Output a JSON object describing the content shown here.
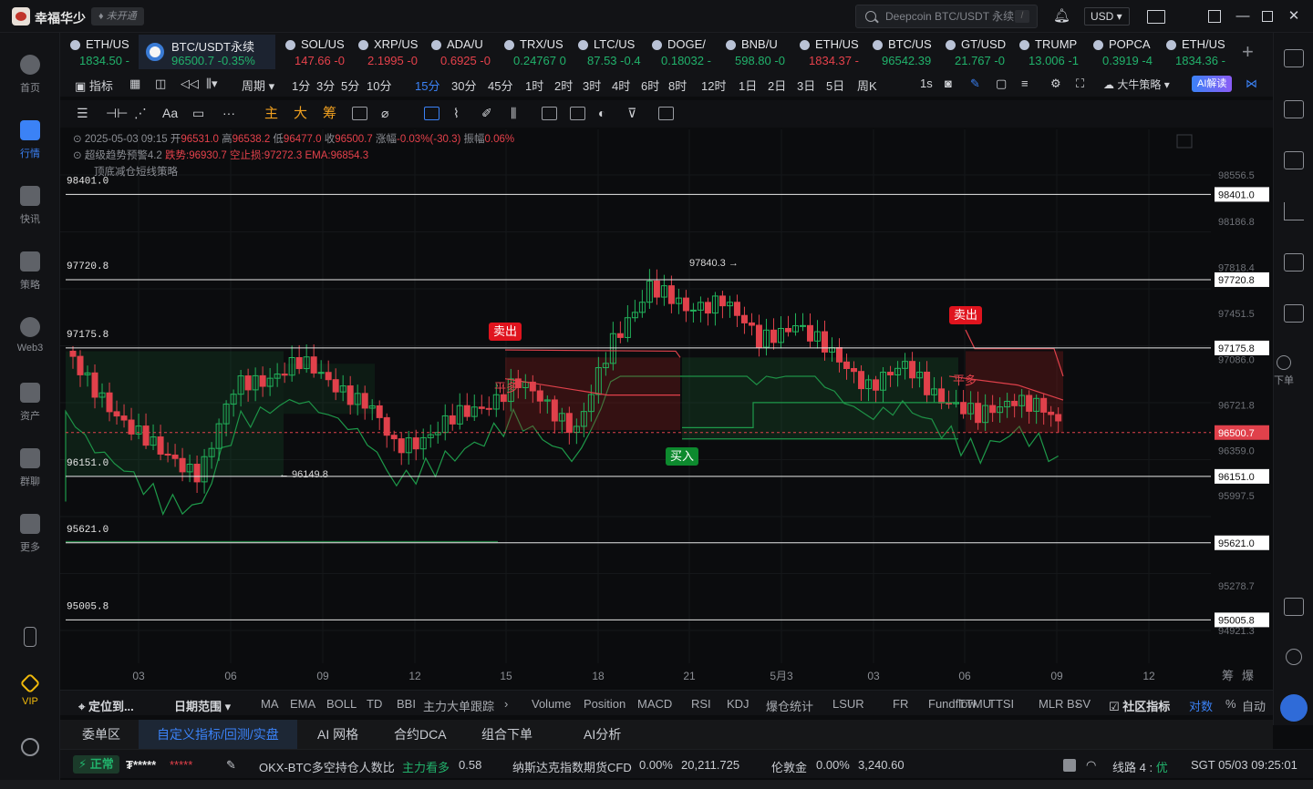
{
  "app": {
    "username": "幸福华少",
    "account_badge": "未开通",
    "search_placeholder": "Deepcoin BTC/USDT 永续",
    "search_shortcut": "/",
    "currency": "USD"
  },
  "sidebar": {
    "items": [
      {
        "label": "首页"
      },
      {
        "label": "行情",
        "active": true
      },
      {
        "label": "快讯"
      },
      {
        "label": "策略"
      },
      {
        "label": "Web3"
      },
      {
        "label": "资产"
      },
      {
        "label": "群聊"
      },
      {
        "label": "更多"
      }
    ],
    "vip_label": "VIP"
  },
  "right_sidebar": {
    "order_label": "下单"
  },
  "tabs": [
    {
      "name": "ETH/US",
      "price": "1834.50",
      "change": "-",
      "dir": "up"
    },
    {
      "name": "BTC/USDT永续",
      "price": "96500.7",
      "change": "-0.35%",
      "dir": "up",
      "active": true
    },
    {
      "name": "SOL/US",
      "price": "147.66",
      "change": "-0",
      "dir": "dn"
    },
    {
      "name": "XRP/US",
      "price": "2.1995",
      "change": "-0",
      "dir": "dn"
    },
    {
      "name": "ADA/U",
      "price": "0.6925",
      "change": "-0",
      "dir": "dn"
    },
    {
      "name": "TRX/US",
      "price": "0.24767",
      "change": "0",
      "dir": "up"
    },
    {
      "name": "LTC/US",
      "price": "87.53",
      "change": "-0.4",
      "dir": "up"
    },
    {
      "name": "DOGE/",
      "price": "0.18032",
      "change": "-",
      "dir": "up"
    },
    {
      "name": "BNB/U",
      "price": "598.80",
      "change": "-0",
      "dir": "up"
    },
    {
      "name": "ETH/US",
      "price": "1834.37",
      "change": "-",
      "dir": "dn"
    },
    {
      "name": "BTC/US",
      "price": "96542.39",
      "change": "",
      "dir": "up"
    },
    {
      "name": "GT/USD",
      "price": "21.767",
      "change": "-0",
      "dir": "up"
    },
    {
      "name": "TRUMP",
      "price": "13.006",
      "change": "-1",
      "dir": "up"
    },
    {
      "name": "POPCA",
      "price": "0.3919",
      "change": "-4",
      "dir": "up"
    },
    {
      "name": "ETH/US",
      "price": "1834.36",
      "change": "-",
      "dir": "up"
    }
  ],
  "toolbar": {
    "indicator_label": "指标",
    "period_label": "周期",
    "timeframes": [
      "1分",
      "3分",
      "5分",
      "10分",
      "15分",
      "30分",
      "45分",
      "1时",
      "2时",
      "3时",
      "4时",
      "6时",
      "8时",
      "12时",
      "1日",
      "2日",
      "3日",
      "5日",
      "周K"
    ],
    "selected_timeframe": "15分",
    "interval_label": "1s",
    "strategy_label": "大牛策略",
    "ai_label": "AI解读"
  },
  "draw_toolbar": {
    "main": "主",
    "big": "大",
    "chip": "筹",
    "font": "Aa"
  },
  "chart_info": {
    "datetime": "2025-05-03 09:15",
    "open_label": "开",
    "open": "96531.0",
    "high_label": "高",
    "high": "96538.2",
    "low_label": "低",
    "low": "96477.0",
    "close_label": "收",
    "close": "96500.7",
    "change_label": "涨幅",
    "change": "-0.03%(-30.3)",
    "amp_label": "振幅",
    "amp": "0.06%",
    "indicator_name": "超级趋势预警4.2",
    "indicator_values": "跌势:96930.7  空止损:97272.3  EMA:96854.3",
    "strategy_name": "顶底减仓短线策略"
  },
  "chart_data": {
    "type": "candlestick",
    "price_axis": [
      "98556.5",
      "98186.8",
      "97818.4",
      "97451.5",
      "97086.0",
      "96721.8",
      "96359.0",
      "95997.5",
      "95278.7",
      "94921.3"
    ],
    "time_axis": [
      "03",
      "06",
      "09",
      "12",
      "15",
      "18",
      "21",
      "5月3",
      "03",
      "06",
      "09",
      "12"
    ],
    "level_lines": [
      {
        "value": "98401.0"
      },
      {
        "value": "97720.8"
      },
      {
        "value": "97175.8"
      },
      {
        "value": "96151.0"
      },
      {
        "value": "95621.0"
      },
      {
        "value": "95005.8"
      }
    ],
    "current_price": "96500.7",
    "annotations": {
      "high_marker": "97840.3",
      "low_marker": "96149.8",
      "sell1": "卖出",
      "sell2": "卖出",
      "close_long1": "平多",
      "close_long2": "平多",
      "buy": "买入"
    },
    "axis_corner": [
      "筹",
      "爆"
    ]
  },
  "indicators": {
    "locate_label": "定位到...",
    "range_label": "日期范围",
    "items1": [
      "MA",
      "EMA",
      "BOLL",
      "TD",
      "BBI",
      "主力大单跟踪"
    ],
    "items2": [
      "Volume",
      "Position",
      "MACD",
      "RSI",
      "KDJ",
      "爆仓统计",
      "LSUR",
      "FR",
      "Fundflow",
      "TTMU",
      "TTSI",
      "MLR",
      "BSV"
    ],
    "community_label": "社区指标",
    "log_label": "对数",
    "pct_label": "%",
    "auto_label": "自动"
  },
  "bottom_tabs": [
    "委单区",
    "自定义指标/回测/实盘",
    "AI 网格",
    "合约DCA",
    "组合下单",
    "AI分析"
  ],
  "status": {
    "state": "正常",
    "masked1": "₮*****",
    "masked2": "*****",
    "ratio_label": "OKX-BTC多空持仓人数比",
    "ratio_tag": "主力看多",
    "ratio_val": "0.58",
    "nasdaq_label": "纳斯达克指数期货CFD",
    "nasdaq_pct": "0.00%",
    "nasdaq_val": "20,211.725",
    "gold_label": "伦敦金",
    "gold_pct": "0.00%",
    "gold_val": "3,240.60",
    "line_label": "线路 4 :",
    "line_quality": "优",
    "time": "SGT 05/03 09:25:01"
  }
}
